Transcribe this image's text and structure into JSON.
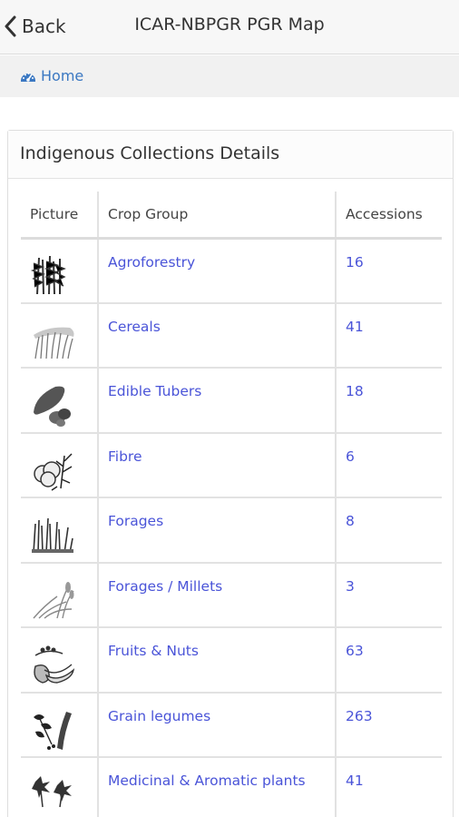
{
  "header": {
    "back_label": "Back",
    "title": "ICAR-NBPGR PGR Map"
  },
  "breadcrumb": {
    "home_label": "Home"
  },
  "panel": {
    "title": "Indigenous Collections Details",
    "columns": {
      "picture": "Picture",
      "crop_group": "Crop Group",
      "accessions": "Accessions"
    },
    "rows": [
      {
        "crop_group": "Agroforestry",
        "accessions": "16",
        "icon": "agroforestry-icon"
      },
      {
        "crop_group": "Cereals",
        "accessions": "41",
        "icon": "cereals-icon"
      },
      {
        "crop_group": "Edible Tubers",
        "accessions": "18",
        "icon": "tubers-icon"
      },
      {
        "crop_group": "Fibre",
        "accessions": "6",
        "icon": "fibre-icon"
      },
      {
        "crop_group": "Forages",
        "accessions": "8",
        "icon": "forages-icon"
      },
      {
        "crop_group": "Forages / Millets",
        "accessions": "3",
        "icon": "millets-icon"
      },
      {
        "crop_group": "Fruits & Nuts",
        "accessions": "63",
        "icon": "fruits-icon"
      },
      {
        "crop_group": "Grain legumes",
        "accessions": "263",
        "icon": "legumes-icon"
      },
      {
        "crop_group": "Medicinal & Aromatic plants",
        "accessions": "41",
        "icon": "medicinal-icon"
      }
    ]
  },
  "colors": {
    "link": "#4a54d8",
    "home_link": "#3b78c2"
  }
}
